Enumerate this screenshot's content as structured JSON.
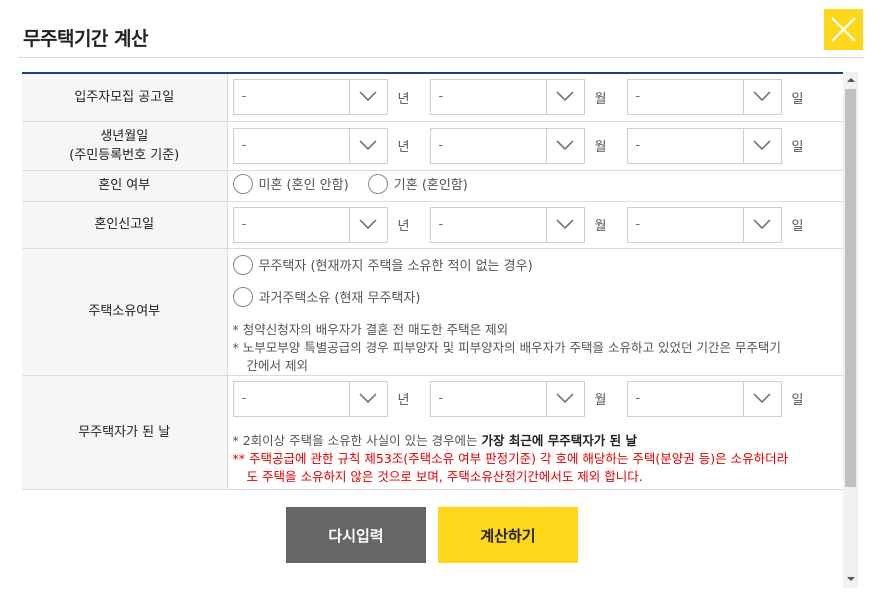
{
  "modal": {
    "title": "무주택기간 계산",
    "close_icon": "close-icon"
  },
  "colors": {
    "accent": "#ffd71a",
    "table_top_border": "#1f3d7a",
    "warning_text": "#e00000",
    "reset_button": "#666666"
  },
  "units": {
    "year": "년",
    "month": "월",
    "day": "일"
  },
  "select_placeholder": "-",
  "rows": {
    "announce_date": {
      "label": "입주자모집 공고일"
    },
    "birth_date": {
      "label_line1": "생년월일",
      "label_line2": "(주민등록번호 기준)"
    },
    "marriage": {
      "label": "혼인 여부",
      "option_single": "미혼 (혼인 안함)",
      "option_married": "기혼 (혼인함)"
    },
    "marriage_date": {
      "label": "혼인신고일"
    },
    "ownership": {
      "label": "주택소유여부",
      "option_never": "무주택자 (현재까지 주택을 소유한 적이 없는 경우)",
      "option_past": "과거주택소유 (현재 무주택자)",
      "note1": "* 청약신청자의 배우자가 결혼 전 매도한 주택은 제외",
      "note2_line1": "* 노부모부양 특별공급의 경우 피부양자 및 피부양자의 배우자가 주택을 소유하고 있었던 기간은 무주택기",
      "note2_line2": "간에서 제외"
    },
    "homeless_date": {
      "label": "무주택자가 된 날",
      "note1_pre": "* 2회이상 주택을 소유한 사실이 있는 경우에는 ",
      "note1_bold": "가장 최근에 무주택자가 된 날",
      "note2_line1": "** 주택공급에 관한 규칙 제53조(주택소유 여부 판정기준) 각 호에 해당하는 주택(분양권 등)은 소유하더라",
      "note2_line2": "도 주택을 소유하지 않은 것으로 보며, 주택소유산정기간에서도 제외 합니다."
    }
  },
  "buttons": {
    "reset": "다시입력",
    "calculate": "계산하기"
  }
}
